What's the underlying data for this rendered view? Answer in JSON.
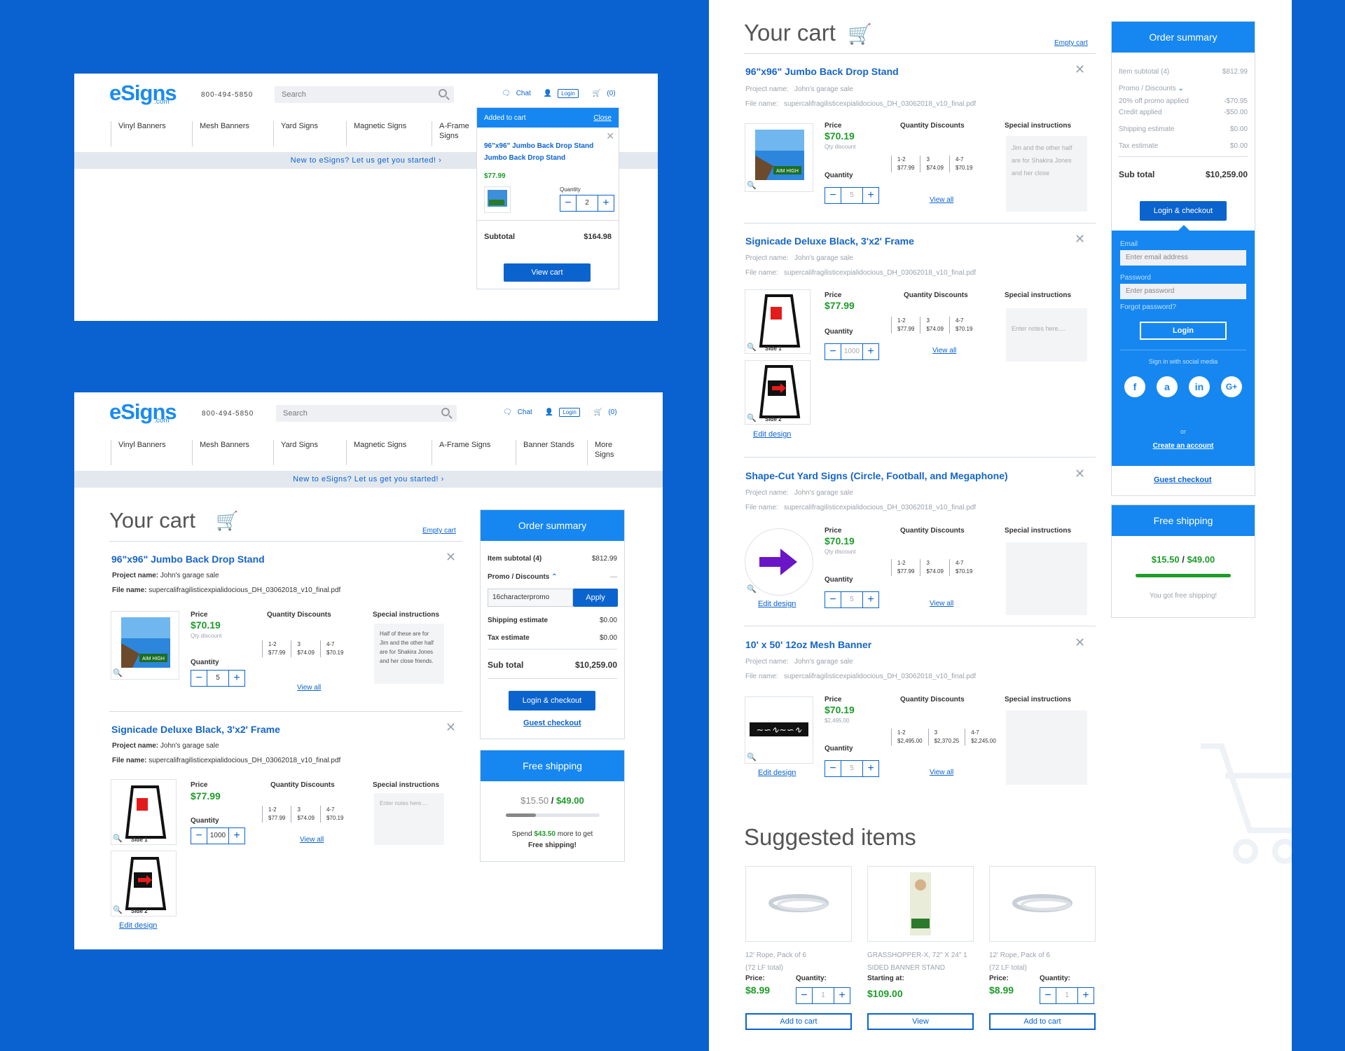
{
  "brand": {
    "logo": "eSigns",
    "logo_sub": ".com",
    "phone": "800-494-5850"
  },
  "header": {
    "search_placeholder": "Search",
    "chat": "Chat",
    "login": "Login",
    "cart_count": "(0)"
  },
  "nav": [
    "Vinyl Banners",
    "Mesh Banners",
    "Yard Signs",
    "Magnetic Signs",
    "A-Frame Signs",
    "Banner Stands",
    "More Signs"
  ],
  "banner": "New to eSigns? Let us get you started! ›",
  "popup": {
    "title": "Added to cart",
    "close": "Close",
    "item": "96\"x96\" Jumbo Back Drop Stand Jumbo Back Drop Stand",
    "price": "$77.99",
    "qty_label": "Quantity",
    "qty": "2",
    "subtotal_label": "Subtotal",
    "subtotal": "$164.98",
    "view_cart": "View cart"
  },
  "cart": {
    "title": "Your cart",
    "empty": "Empty cart"
  },
  "labels": {
    "project": "Project name:",
    "file": "File name:",
    "price": "Price",
    "qty_discounts": "Quantity Discounts",
    "special": "Special instructions",
    "quantity": "Quantity",
    "view_all": "View all",
    "edit_design": "Edit design",
    "qty_discount_note": "Qty discount",
    "side1": "Side 1",
    "side2": "Side 2"
  },
  "items": [
    {
      "name": "96\"x96\" Jumbo Back Drop Stand",
      "project": "John's garage sale",
      "file": "supercalifragilisticexpialidocious_DH_03062018_v10_final.pdf",
      "price": "$70.19",
      "qty": "5",
      "tiers": [
        "1-2",
        "3",
        "4-7"
      ],
      "tier_prices": [
        "$77.99",
        "$74.09",
        "$70.19"
      ],
      "notes": "Half of these are for Jim and the other half are for Shakira Jones and her close friends.",
      "notes_right": "Jim and the other half are for Shakira Jones and her close"
    },
    {
      "name": "Signicade Deluxe Black, 3'x2' Frame",
      "project": "John's garage sale",
      "file": "supercalifragilisticexpialidocious_DH_03062018_v10_final.pdf",
      "price": "$77.99",
      "qty": "1000",
      "tiers": [
        "1-2",
        "3",
        "4-7"
      ],
      "tier_prices": [
        "$77.99",
        "$74.09",
        "$70.19"
      ],
      "notes": "Enter notes here....",
      "notes_right": "Enter notes here...."
    },
    {
      "name": "Shape-Cut Yard Signs (Circle, Football, and Megaphone)",
      "project": "John's garage sale",
      "file": "supercalifragilisticexpialidocious_DH_03062018_v10_final.pdf",
      "price": "$70.19",
      "qty": "5",
      "tiers": [
        "1-2",
        "3",
        "4-7"
      ],
      "tier_prices": [
        "$77.99",
        "$74.09",
        "$70.19"
      ]
    },
    {
      "name": "10' x 50' 12oz Mesh Banner",
      "project": "John's garage sale",
      "file": "supercalifragilisticexpialidocious_DH_03062018_v10_final.pdf",
      "price": "$70.19",
      "price_note": "$2,495.00",
      "qty": "5",
      "tiers": [
        "1-2",
        "3",
        "4-7"
      ],
      "tier_prices": [
        "$2,495.00",
        "$2,370.25",
        "$2,245.00"
      ]
    }
  ],
  "summary": {
    "title": "Order summary",
    "item_subtotal": "Item subtotal (4)",
    "item_subtotal_val": "$812.99",
    "promo": "Promo / Discounts",
    "promo_code": "16characterpromo",
    "apply": "Apply",
    "promo_applied": "20% off promo applied",
    "promo_val": "-$70.95",
    "credit": "Credit applied",
    "credit_val": "-$50.00",
    "shipping": "Shipping estimate",
    "shipping_val": "$0.00",
    "tax": "Tax estimate",
    "tax_val": "$0.00",
    "subtotal": "Sub total",
    "subtotal_val": "$10,259.00",
    "login_checkout": "Login & checkout",
    "guest": "Guest checkout",
    "dash": "—"
  },
  "login": {
    "email": "Email",
    "email_ph": "Enter email address",
    "password": "Password",
    "password_ph": "Enter password",
    "forgot": "Forgot password?",
    "login": "Login",
    "social": "Sign in with social media",
    "or": "or",
    "create": "Create an account",
    "fb": "f",
    "amazon": "a",
    "linkedin": "in",
    "google": "G+"
  },
  "shipping": {
    "title": "Free shipping",
    "current": "$15.50",
    "slash": "/",
    "goal": "$49.00",
    "progress": 0.32,
    "progress_full": 1.0,
    "spend": "Spend",
    "more": "$43.50",
    "rest": "more to get",
    "free": "Free shipping!",
    "got": "You got free shipping!"
  },
  "suggested": {
    "title": "Suggested items",
    "items": [
      {
        "name": "12' Rope, Pack of 6",
        "name2": "(72 LF total)",
        "price_label": "Price:",
        "price": "$8.99",
        "qty_label": "Quantity:",
        "qty": "1",
        "btn": "Add to cart"
      },
      {
        "name": "GRASSHOPPER-X, 72\" X 24\" 1",
        "name2": "SIDED BANNER STAND",
        "price_label": "Starting at:",
        "price": "$109.00",
        "btn": "View"
      },
      {
        "name": "12' Rope, Pack of 6",
        "name2": "(72 LF total)",
        "price_label": "Price:",
        "price": "$8.99",
        "qty_label": "Quantity:",
        "qty": "1",
        "btn": "Add to cart"
      }
    ]
  },
  "ad_text": "AIM HIGH"
}
